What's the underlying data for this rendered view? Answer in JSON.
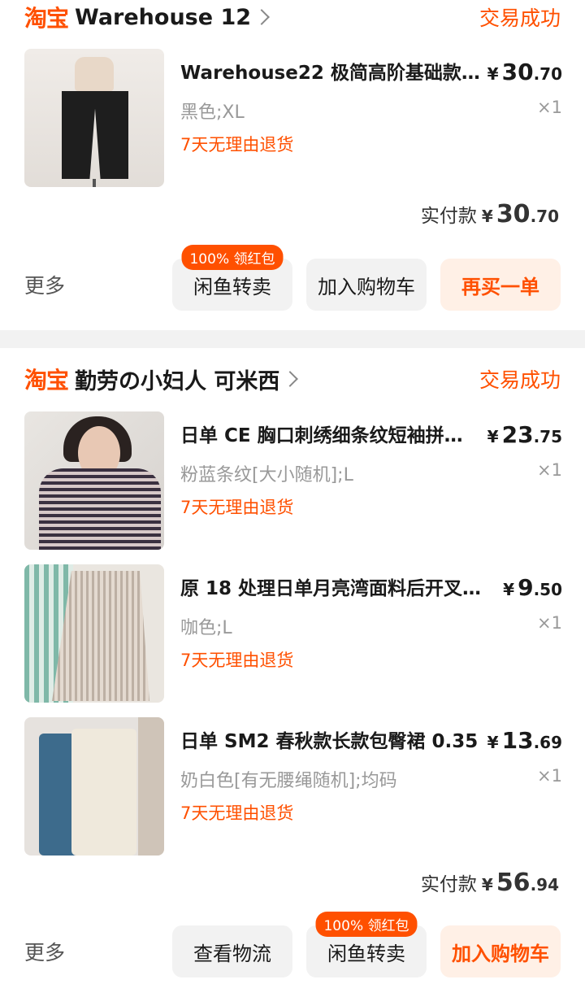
{
  "orders": [
    {
      "platform_logo": "淘宝",
      "shop_name": "Warehouse 12",
      "status": "交易成功",
      "items": [
        {
          "title": "Warehouse22  极简高阶基础款…",
          "price_int": "30",
          "price_dec": ".70",
          "currency": "¥",
          "spec": "黑色;XL",
          "qty": "×1",
          "return_policy": "7天无理由退货",
          "thumbnail_icon": "black-shorts-photo"
        }
      ],
      "paid_label": "实付款",
      "paid_currency": "¥",
      "paid_int": "30",
      "paid_dec": ".70",
      "actions": {
        "more": "更多",
        "btn1": "闲鱼转卖",
        "btn1_badge": "100% 领红包",
        "btn2": "加入购物车",
        "btn3": "再买一单"
      }
    },
    {
      "platform_logo": "淘宝",
      "shop_name": "勤劳の小妇人 可米西",
      "status": "交易成功",
      "items": [
        {
          "title": "日单 CE 胸口刺绣细条纹短袖拼…",
          "price_int": "23",
          "price_dec": ".75",
          "currency": "¥",
          "spec": "粉蓝条纹[大小随机];L",
          "qty": "×1",
          "return_policy": "7天无理由退货",
          "thumbnail_icon": "striped-tshirt-photo"
        },
        {
          "title": "原 18 处理日单月亮湾面料后开叉…",
          "price_int": "9",
          "price_dec": ".50",
          "currency": "¥",
          "spec": "咖色;L",
          "qty": "×1",
          "return_policy": "7天无理由退货",
          "thumbnail_icon": "pleated-skirt-photo"
        },
        {
          "title": "日单 SM2 春秋款长款包臀裙 0.35",
          "price_int": "13",
          "price_dec": ".69",
          "currency": "¥",
          "spec": "奶白色[有无腰绳随机];均码",
          "qty": "×1",
          "return_policy": "7天无理由退货",
          "thumbnail_icon": "long-skirts-photo"
        }
      ],
      "paid_label": "实付款",
      "paid_currency": "¥",
      "paid_int": "56",
      "paid_dec": ".94",
      "actions": {
        "more": "更多",
        "btn1": "查看物流",
        "btn2": "闲鱼转卖",
        "btn2_badge": "100% 领红包",
        "btn3": "加入购物车"
      }
    }
  ],
  "colors": {
    "accent": "#ff5000",
    "primary_button_bg": "#fff0e6",
    "secondary_button_bg": "#f2f2f2",
    "muted_text": "#999999"
  }
}
